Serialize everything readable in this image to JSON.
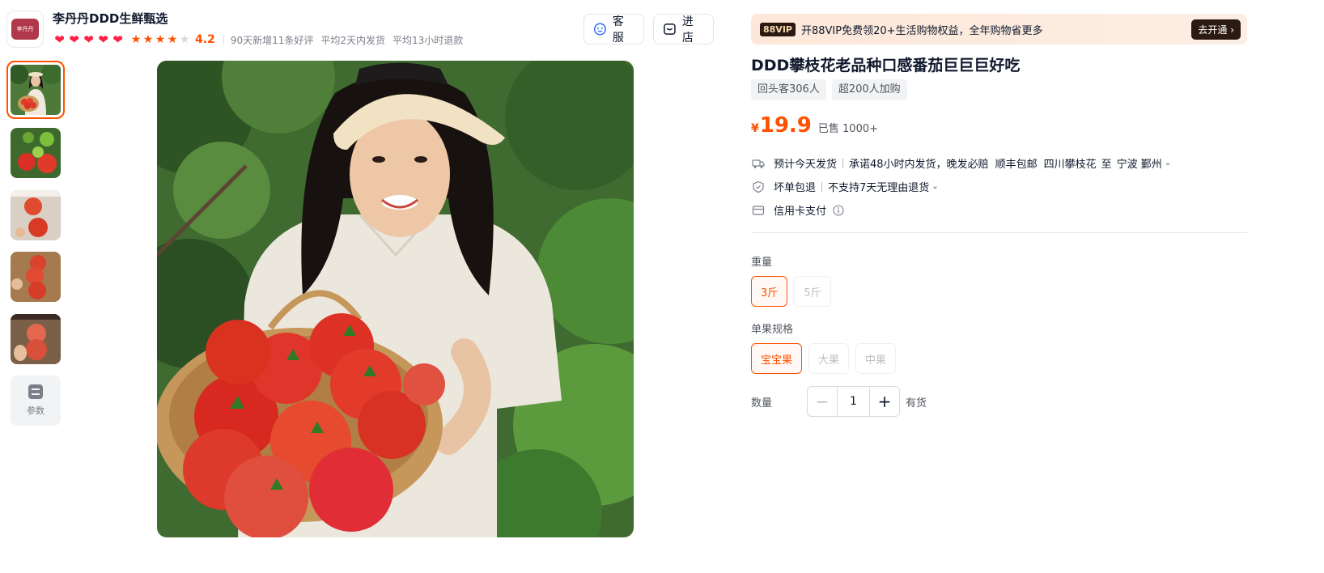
{
  "shop": {
    "logo_text": "李丹丹",
    "name": "李丹丹DDD生鲜甄选",
    "hearts_count": 5,
    "stars_filled": 4,
    "stars_total": 5,
    "rating": "4.2",
    "meta": [
      "90天新增11条好评",
      "平均2天内发货",
      "平均13小时退款"
    ],
    "service_label": "客服",
    "enter_shop_label": "进店"
  },
  "gallery": {
    "thumbnails": 5,
    "active_index": 0,
    "params_label": "参数"
  },
  "vip": {
    "badge": "88VIP",
    "text": "开88VIP免费领20+生活购物权益，全年购物省更多",
    "button": "去开通 ›"
  },
  "product": {
    "title": "DDD攀枝花老品种口感番茄巨巨巨好吃",
    "tags": [
      "回头客306人",
      "超200人加购"
    ],
    "currency": "¥",
    "price": "19.9",
    "sold": "已售 1000+"
  },
  "delivery": {
    "ship": "预计今天发货",
    "promise": "承诺48小时内发货，晚发必赔",
    "shipping": "顺丰包邮",
    "from": "四川攀枝花",
    "to_word": "至",
    "dest": "宁波 鄞州"
  },
  "guarantee": {
    "refund": "坏单包退",
    "return": "不支持7天无理由退货"
  },
  "payment": {
    "text": "信用卡支付"
  },
  "sku": {
    "weight_label": "重量",
    "weight_options": [
      "3斤",
      "5斤"
    ],
    "weight_selected": 0,
    "size_label": "单果规格",
    "size_options": [
      "宝宝果",
      "大果",
      "中果"
    ],
    "size_selected": 0,
    "qty_label": "数量",
    "qty_value": "1",
    "stock": "有货"
  },
  "colors": {
    "accent": "#ff5000",
    "heart": "#ff1f44",
    "text": "#11192d",
    "muted": "#50555f"
  }
}
